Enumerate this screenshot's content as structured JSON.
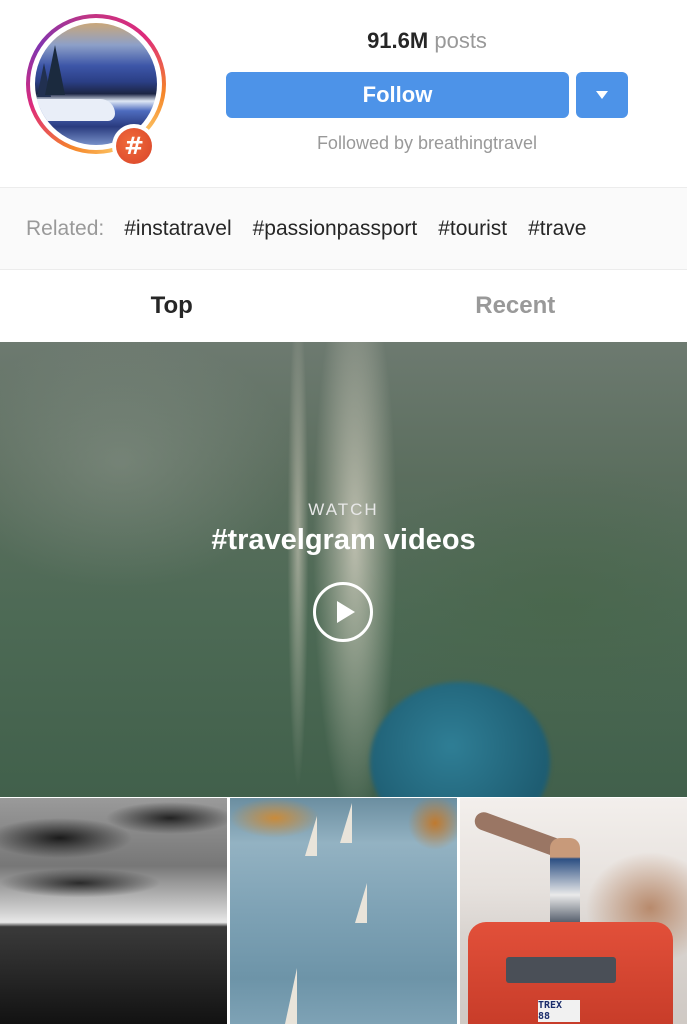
{
  "header": {
    "avatar_alt": "snowy lake hashtag cover",
    "badge_icon": "#",
    "post_count": "91.6M",
    "post_count_label": "posts",
    "follow_label": "Follow",
    "dropdown_icon": "chevron-down-icon",
    "followed_by": "Followed by breathingtravel",
    "brand_color": "#4d93e8"
  },
  "related": {
    "label": "Related:",
    "tags": [
      "#instatravel",
      "#passionpassport",
      "#tourist",
      "#trave"
    ]
  },
  "tabs": {
    "items": [
      {
        "label": "Top",
        "active": true
      },
      {
        "label": "Recent",
        "active": false
      }
    ]
  },
  "video": {
    "eyebrow": "WATCH",
    "title": "#travelgram videos",
    "play_icon": "play-icon"
  },
  "grid": {
    "posts": [
      {
        "description": "black and white sea under clouds"
      },
      {
        "description": "sailboats on river"
      },
      {
        "description": "man sitting on red convertible with dinosaur statue",
        "plate_text": "TREX 88"
      }
    ]
  }
}
